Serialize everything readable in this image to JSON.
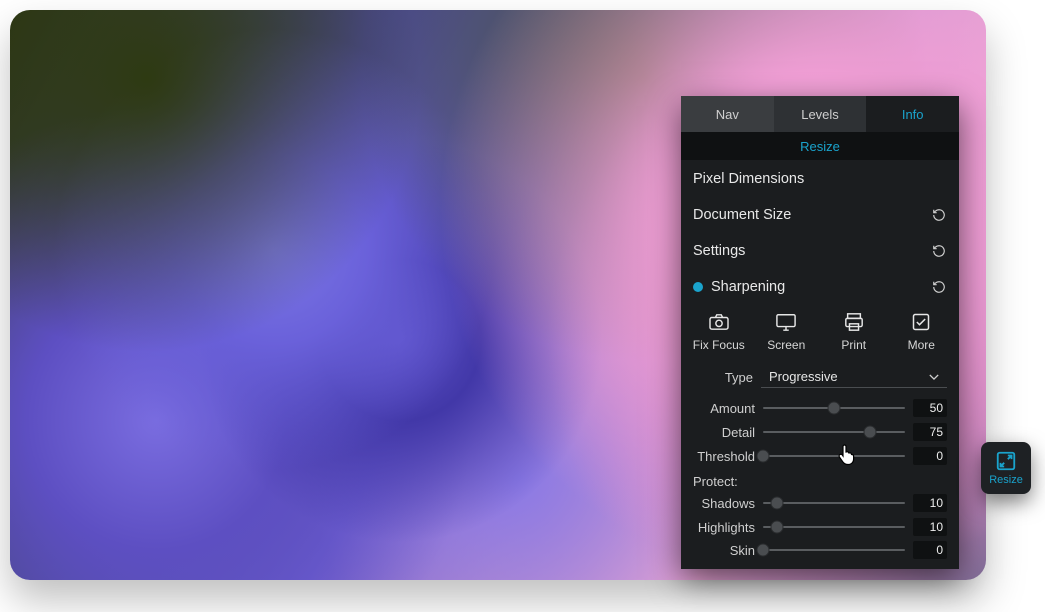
{
  "tabs": {
    "nav": "Nav",
    "levels": "Levels",
    "info": "Info"
  },
  "resize_header": "Resize",
  "sections": {
    "pixel_dimensions": "Pixel Dimensions",
    "document_size": "Document Size",
    "settings": "Settings",
    "sharpening": "Sharpening"
  },
  "presets": {
    "fix_focus": "Fix Focus",
    "screen": "Screen",
    "print": "Print",
    "more": "More"
  },
  "type": {
    "label": "Type",
    "value": "Progressive"
  },
  "sliders": {
    "amount": {
      "label": "Amount",
      "value": 50
    },
    "detail": {
      "label": "Detail",
      "value": 75
    },
    "threshold": {
      "label": "Threshold",
      "value": 0
    }
  },
  "protect": {
    "label": "Protect:",
    "shadows": {
      "label": "Shadows",
      "value": 10
    },
    "highlights": {
      "label": "Highlights",
      "value": 10
    },
    "skin": {
      "label": "Skin",
      "value": 0
    }
  },
  "float_badge": "Resize",
  "colors": {
    "accent": "#1aa3cc"
  }
}
